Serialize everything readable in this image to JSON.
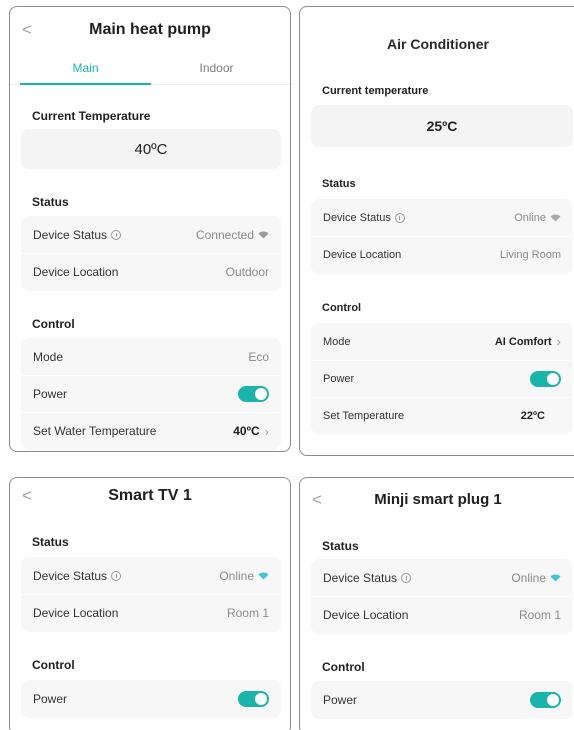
{
  "cards": {
    "heat_pump": {
      "back": "<",
      "title": "Main heat pump",
      "tabs": [
        "Main",
        "Indoor"
      ],
      "current_temperature_label": "Current Temperature",
      "current_temperature_value": "40ºC",
      "status_label": "Status",
      "device_status_label": "Device Status",
      "device_status_value": "Connected",
      "device_location_label": "Device Location",
      "device_location_value": "Outdoor",
      "control_label": "Control",
      "mode_label": "Mode",
      "mode_value": "Eco",
      "power_label": "Power",
      "power_on": true,
      "set_water_temp_label": "Set Water Temperature",
      "set_water_temp_value": "40ºC"
    },
    "air_conditioner": {
      "title": "Air Conditioner",
      "current_temperature_label": "Current temperature",
      "current_temperature_value": "25ºC",
      "status_label": "Status",
      "device_status_label": "Device Status",
      "device_status_value": "Online",
      "device_location_label": "Device Location",
      "device_location_value": "Living Room",
      "control_label": "Control",
      "mode_label": "Mode",
      "mode_value": "AI Comfort",
      "power_label": "Power",
      "power_on": true,
      "set_temp_label": "Set Temperature",
      "set_temp_value": "22ºC"
    },
    "smart_tv": {
      "back": "<",
      "title": "Smart TV 1",
      "status_label": "Status",
      "device_status_label": "Device Status",
      "device_status_value": "Online",
      "device_location_label": "Device Location",
      "device_location_value": "Room 1",
      "control_label": "Control",
      "power_label": "Power",
      "power_on": true
    },
    "smart_plug": {
      "back": "<",
      "title": "Minji smart plug 1",
      "status_label": "Status",
      "device_status_label": "Device Status",
      "device_status_value": "Online",
      "device_location_label": "Device Location",
      "device_location_value": "Room 1",
      "control_label": "Control",
      "power_label": "Power",
      "power_on": true
    }
  },
  "colors": {
    "accent": "#19b5aa",
    "row_bg": "#f7f7f7",
    "muted_text": "#8a8a8a",
    "wifi_connected": "#9a9a9a",
    "wifi_online": "#3cc6d6"
  },
  "icons": {
    "back": "chevron-left-icon",
    "info": "info-icon",
    "wifi": "wifi-icon",
    "chevron": "chevron-right-icon",
    "toggle": "toggle-switch"
  }
}
